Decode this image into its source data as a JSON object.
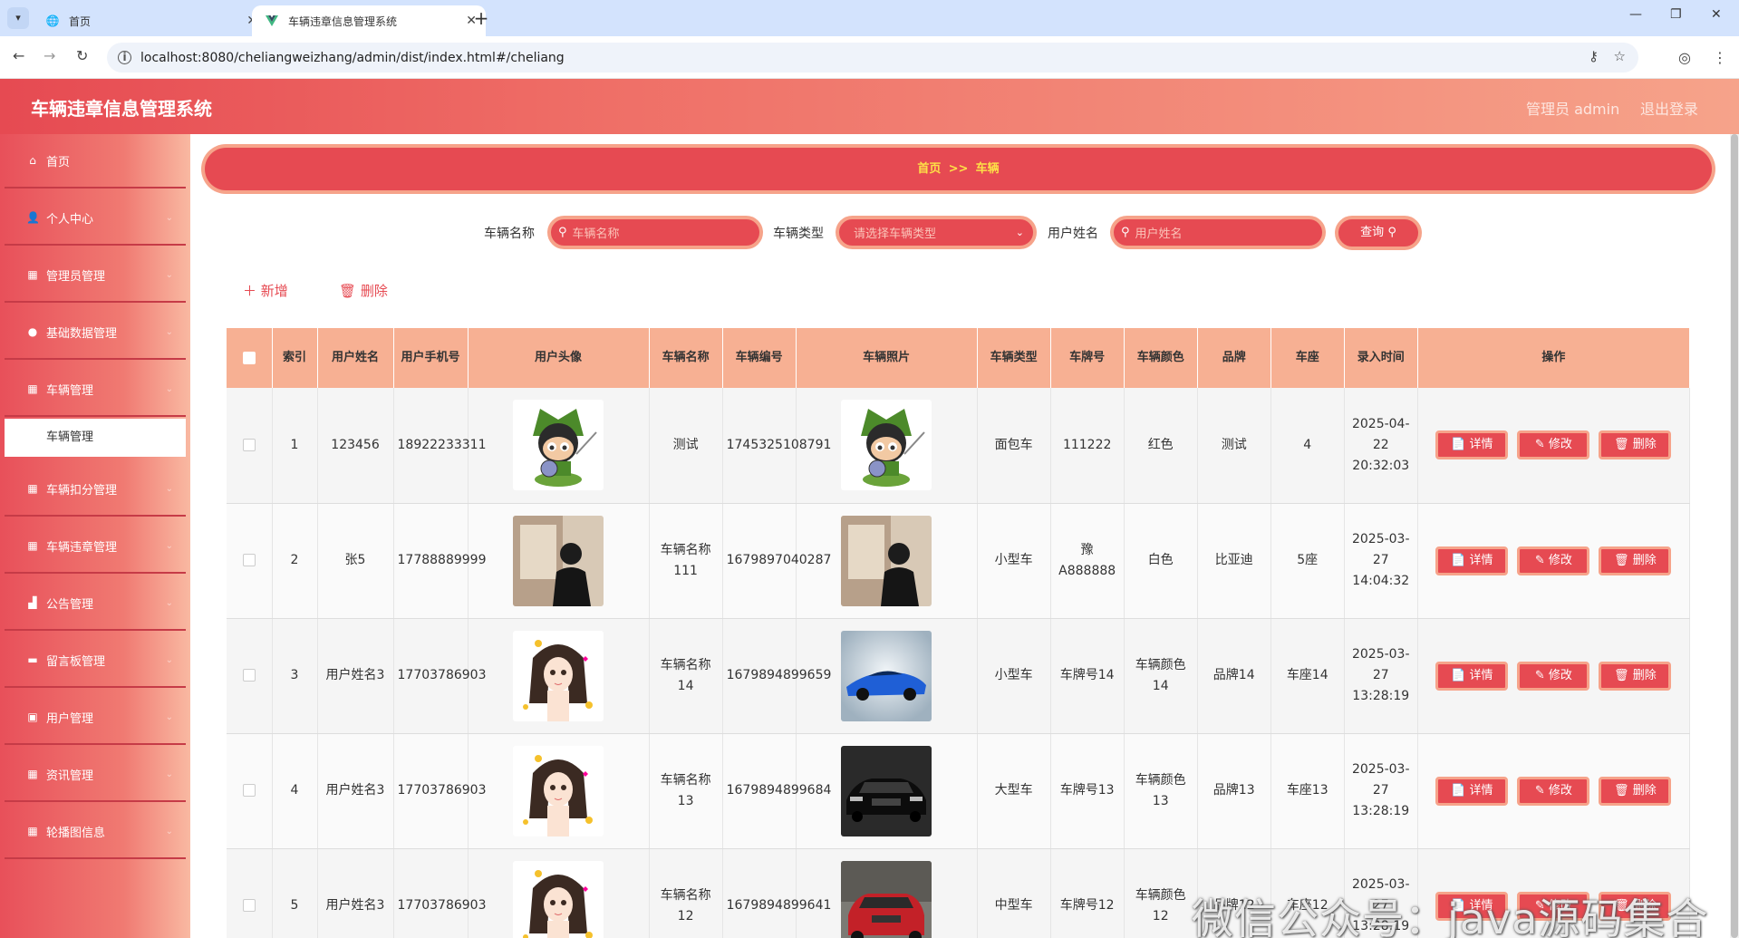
{
  "browser": {
    "tabs": [
      {
        "label": "首页",
        "icon": "globe-icon"
      },
      {
        "label": "车辆违章信息管理系统",
        "icon": "vue-icon"
      }
    ],
    "url": "localhost:8080/cheliangweizhang/admin/dist/index.html#/cheliang"
  },
  "header": {
    "title": "车辆违章信息管理系统",
    "user": "管理员 admin",
    "logout": "退出登录"
  },
  "sidebar": {
    "items": [
      {
        "label": "首页",
        "icon": "home-icon"
      },
      {
        "label": "个人中心",
        "icon": "user-icon"
      },
      {
        "label": "管理员管理",
        "icon": "grid-icon"
      },
      {
        "label": "基础数据管理",
        "icon": "location-icon"
      },
      {
        "label": "车辆管理",
        "icon": "grid-icon"
      },
      {
        "label": "车辆扣分管理",
        "icon": "grid-icon"
      },
      {
        "label": "车辆违章管理",
        "icon": "grid-icon"
      },
      {
        "label": "公告管理",
        "icon": "chart-icon"
      },
      {
        "label": "留言板管理",
        "icon": "message-icon"
      },
      {
        "label": "用户管理",
        "icon": "briefcase-icon"
      },
      {
        "label": "资讯管理",
        "icon": "grid-icon"
      },
      {
        "label": "轮播图信息",
        "icon": "grid-icon"
      }
    ],
    "active_sub": "车辆管理"
  },
  "breadcrumb": {
    "home": "首页",
    "sep": ">>",
    "current": "车辆"
  },
  "filters": {
    "name_label": "车辆名称",
    "name_placeholder": "车辆名称",
    "type_label": "车辆类型",
    "type_placeholder": "请选择车辆类型",
    "user_label": "用户姓名",
    "user_placeholder": "用户姓名",
    "query": "查询"
  },
  "actions": {
    "add": "新增",
    "delete": "删除"
  },
  "table": {
    "columns": [
      "索引",
      "用户姓名",
      "用户手机号",
      "用户头像",
      "车辆名称",
      "车辆编号",
      "车辆照片",
      "车辆类型",
      "车牌号",
      "车辆颜色",
      "品牌",
      "车座",
      "录入时间",
      "操作"
    ],
    "rows": [
      {
        "index": "1",
        "user": "123456",
        "phone": "18922233311",
        "avatar": "octocat",
        "car": "测试",
        "code": "1745325108791",
        "photo": "octocat",
        "type": "面包车",
        "plate": "111222",
        "color": "红色",
        "brand": "测试",
        "seats": "4",
        "time": "2025-04-22 20:32:03"
      },
      {
        "index": "2",
        "user": "张5",
        "phone": "17788889999",
        "avatar": "person",
        "car": "车辆名称111",
        "code": "1679897040287",
        "photo": "person",
        "type": "小型车",
        "plate": "豫A888888",
        "color": "白色",
        "brand": "比亚迪",
        "seats": "5座",
        "time": "2025-03-27 14:04:32"
      },
      {
        "index": "3",
        "user": "用户姓名3",
        "phone": "17703786903",
        "avatar": "girl",
        "car": "车辆名称14",
        "code": "1679894899659",
        "photo": "blue-car",
        "type": "小型车",
        "plate": "车牌号14",
        "color": "车辆颜色14",
        "brand": "品牌14",
        "seats": "车座14",
        "time": "2025-03-27 13:28:19"
      },
      {
        "index": "4",
        "user": "用户姓名3",
        "phone": "17703786903",
        "avatar": "girl",
        "car": "车辆名称13",
        "code": "1679894899684",
        "photo": "black-car",
        "type": "大型车",
        "plate": "车牌号13",
        "color": "车辆颜色13",
        "brand": "品牌13",
        "seats": "车座13",
        "time": "2025-03-27 13:28:19"
      },
      {
        "index": "5",
        "user": "用户姓名3",
        "phone": "17703786903",
        "avatar": "girl",
        "car": "车辆名称12",
        "code": "1679894899641",
        "photo": "red-suv",
        "type": "中型车",
        "plate": "车牌号12",
        "color": "车辆颜色12",
        "brand": "品牌12",
        "seats": "车座12",
        "time": "2025-03-27 13:28:19"
      }
    ],
    "ops": {
      "detail": "详情",
      "edit": "修改",
      "delete": "删除"
    }
  },
  "watermark": "微信公众号：java源码集合"
}
